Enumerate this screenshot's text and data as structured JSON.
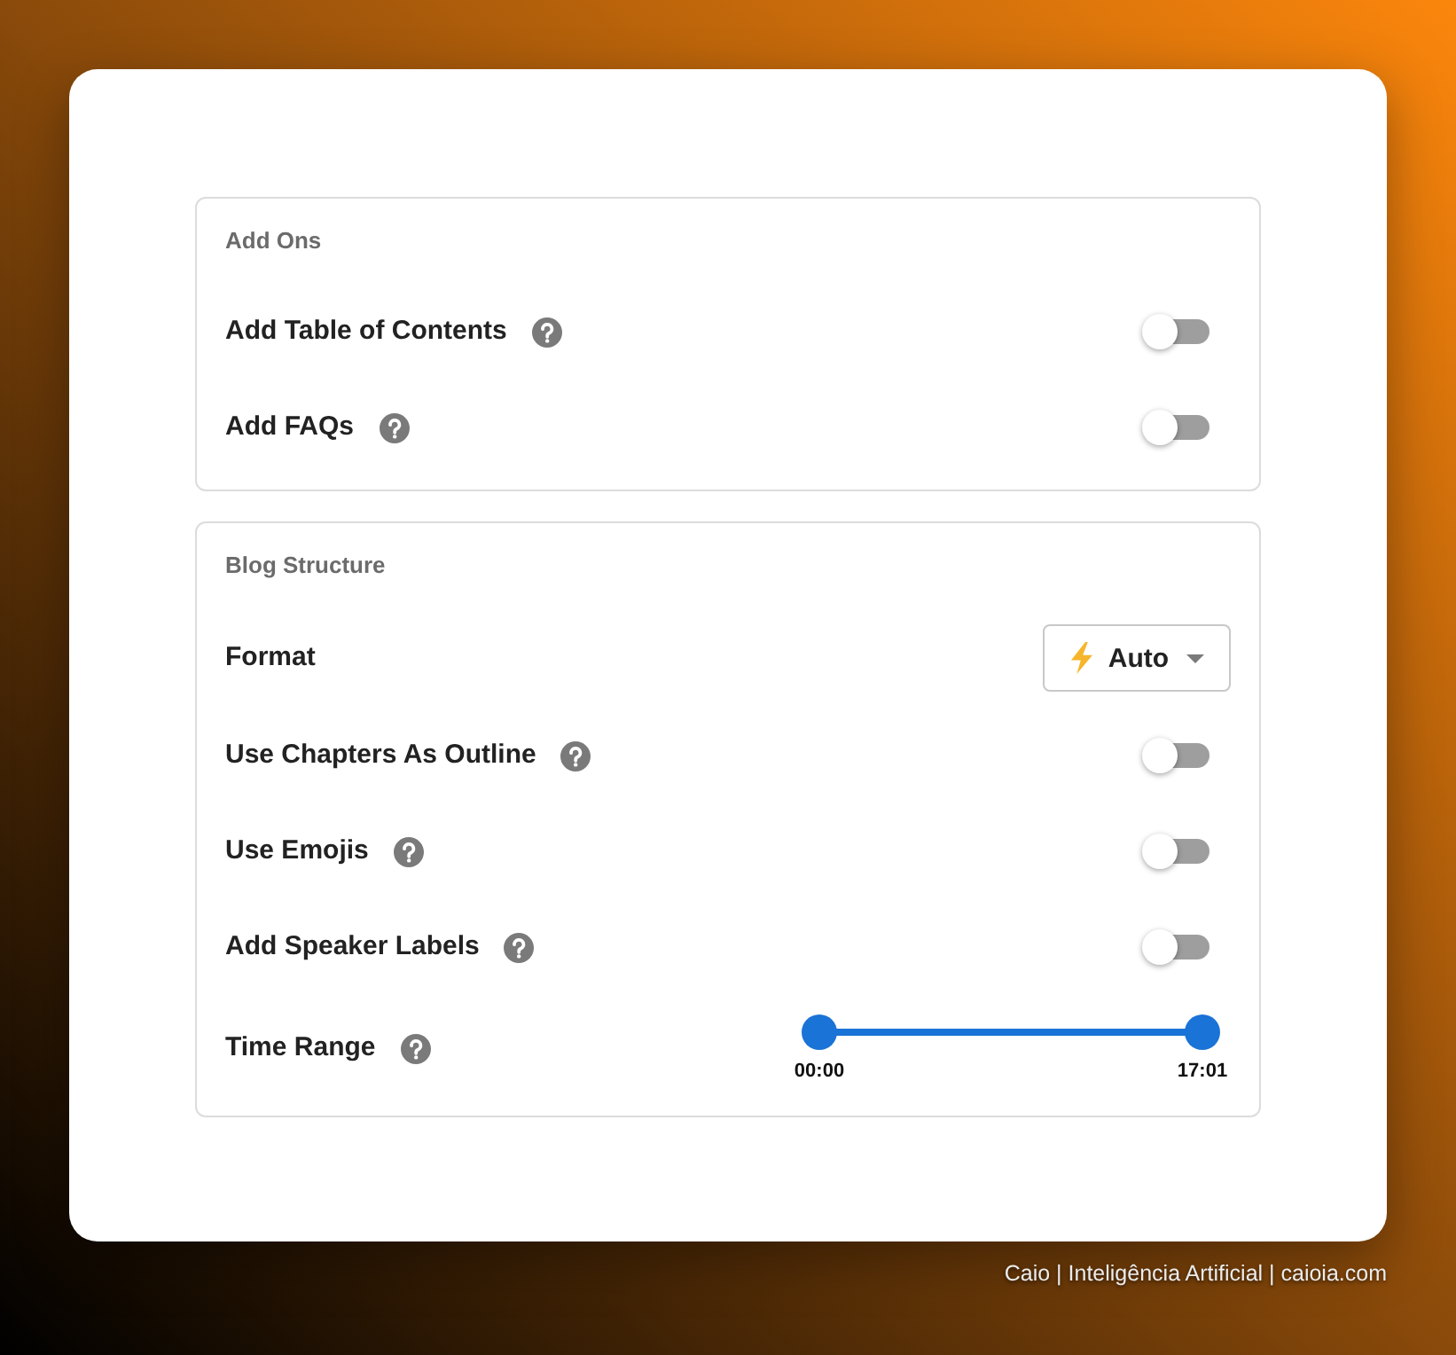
{
  "sections": [
    {
      "title": "Add Ons",
      "rows": [
        {
          "kind": "toggle",
          "label": "Add Table of Contents",
          "help": true,
          "on": false
        },
        {
          "kind": "toggle",
          "label": "Add FAQs",
          "help": true,
          "on": false
        }
      ]
    },
    {
      "title": "Blog Structure",
      "rows": [
        {
          "kind": "select",
          "label": "Format",
          "help": false,
          "value": "Auto"
        },
        {
          "kind": "toggle",
          "label": "Use Chapters As Outline",
          "help": true,
          "on": false
        },
        {
          "kind": "toggle",
          "label": "Use Emojis",
          "help": true,
          "on": false
        },
        {
          "kind": "toggle",
          "label": "Add Speaker Labels",
          "help": true,
          "on": false
        },
        {
          "kind": "range",
          "label": "Time Range",
          "help": true,
          "thumbs": [
            {
              "level": 0,
              "label": "00:00"
            },
            {
              "level": 1,
              "label": "17:01"
            }
          ]
        }
      ]
    }
  ],
  "footer": "Caio | Inteligência Artificial | caioia.com"
}
